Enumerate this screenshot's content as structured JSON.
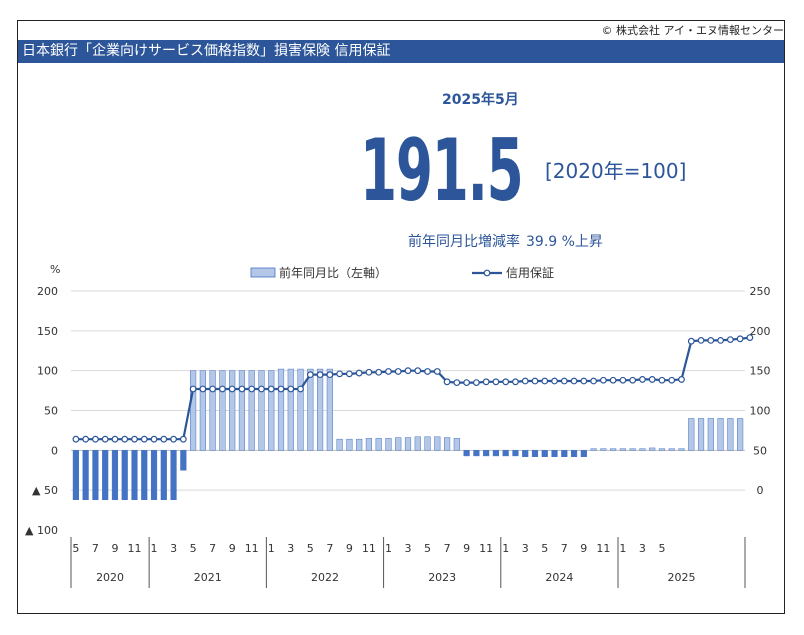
{
  "header": {
    "copyright": "© 株式会社 アイ・エヌ情報センター",
    "title": "日本銀行「企業向けサービス価格指数」損害保険 信用保証"
  },
  "summary": {
    "period": "2025年5月",
    "value": "191.5",
    "base": "[2020年=100]",
    "yoy_label": "前年同月比増減率",
    "yoy_value": "39.9 %上昇"
  },
  "colors": {
    "accent": "#2c5699",
    "bar_pos": "#b4c7e7",
    "bar_neg": "#4472c4",
    "line": "#2c5699"
  },
  "chart_data": {
    "type": "bar",
    "series": [
      {
        "name": "前年同月比（左軸）",
        "axis": "left",
        "kind": "bar",
        "values": [
          -62,
          -62,
          -62,
          -62,
          -62,
          -62,
          -62,
          -62,
          -62,
          -62,
          -62,
          -25,
          100,
          100,
          100,
          100,
          100,
          100,
          100,
          100,
          100,
          102,
          102,
          102,
          102,
          102,
          102,
          14,
          14,
          14,
          15,
          15,
          15,
          16,
          16,
          17,
          17,
          17,
          16,
          15,
          -7,
          -7,
          -7,
          -7,
          -7,
          -7,
          -8,
          -8,
          -8,
          -8,
          -8,
          -8,
          -8,
          2,
          2,
          2,
          2,
          2,
          2,
          3,
          2,
          2,
          2,
          40,
          40,
          40,
          40,
          40,
          40
        ]
      },
      {
        "name": "信用保証",
        "axis": "right",
        "kind": "line",
        "values": [
          64,
          64,
          64,
          64,
          64,
          64,
          64,
          64,
          64,
          64,
          64,
          64,
          127,
          127,
          127,
          127,
          127,
          127,
          127,
          127,
          127,
          127,
          127,
          127,
          145,
          145,
          145,
          146,
          146,
          147,
          148,
          148,
          149,
          149,
          150,
          150,
          149,
          149,
          136,
          135,
          135,
          135,
          136,
          136,
          136,
          136,
          137,
          137,
          137,
          137,
          137,
          137,
          137,
          137,
          138,
          138,
          138,
          138,
          139,
          139,
          138,
          138,
          139,
          187,
          188,
          188,
          188,
          189,
          190,
          191.5
        ]
      }
    ],
    "y_left": {
      "label": "%",
      "ticks": [
        "200",
        "150",
        "100",
        "50",
        "0",
        "▲ 50",
        "▲ 100"
      ],
      "lim": [
        -100,
        200
      ]
    },
    "y_right": {
      "ticks": [
        "250",
        "200",
        "150",
        "100",
        "50",
        "0"
      ],
      "lim": [
        0,
        250
      ]
    },
    "x_month_labels": [
      "5",
      "7",
      "9",
      "11",
      "1",
      "3",
      "5",
      "7",
      "9",
      "11",
      "1",
      "3",
      "5",
      "7",
      "9",
      "11",
      "1",
      "3",
      "5",
      "7",
      "9",
      "11",
      "1",
      "3",
      "5",
      "7",
      "9",
      "11",
      "1",
      "3",
      "5"
    ],
    "x_years": [
      "2020",
      "2021",
      "2022",
      "2023",
      "2024",
      "2025"
    ],
    "legend_position": "top",
    "grid": true
  }
}
